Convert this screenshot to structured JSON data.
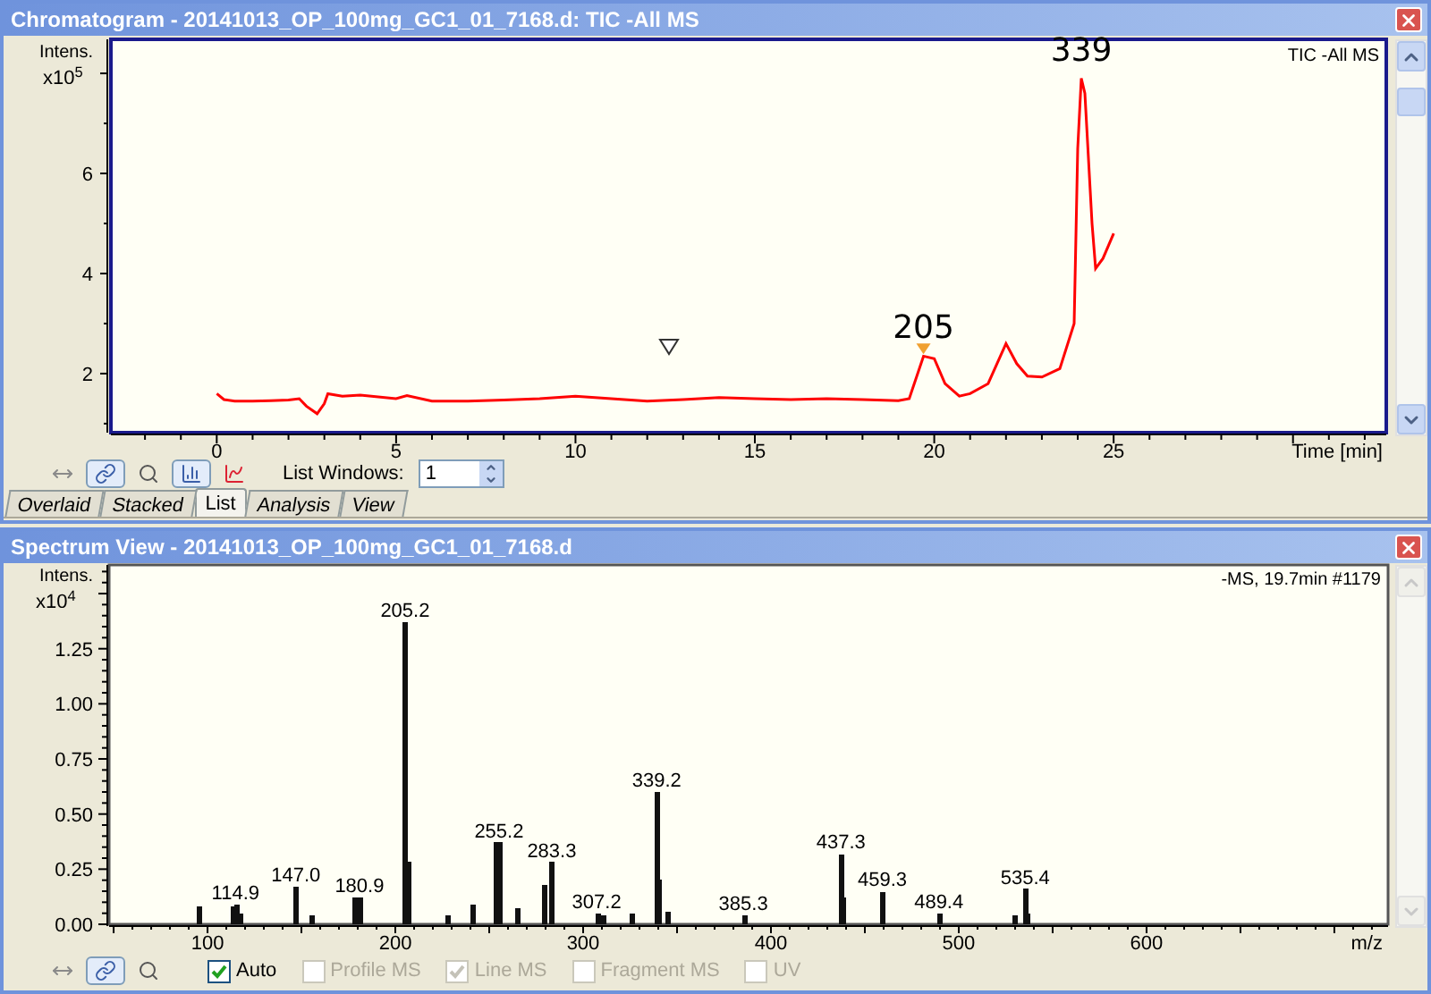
{
  "chromatogram": {
    "title": "Chromatogram - 20141013_OP_100mg_GC1_01_7168.d: TIC -All MS",
    "y_multiplier": "x10$^{5}$",
    "chart_data": {
      "type": "line",
      "xlabel": "Time [min]",
      "ylabel": "Intens.",
      "xlim": [
        -2.95,
        32.6
      ],
      "ylim": [
        0.82,
        8.68
      ],
      "xticks": [
        0,
        5,
        10,
        15,
        20,
        25
      ],
      "yticks": [
        2,
        4,
        6
      ],
      "x": [
        0,
        0.2,
        0.5,
        1,
        1.5,
        2,
        2.3,
        2.5,
        2.8,
        3.0,
        3.1,
        3.5,
        4,
        5,
        5.3,
        6,
        7,
        8,
        9,
        10,
        11,
        12,
        13,
        14,
        15,
        16,
        17,
        18,
        19,
        19.3,
        19.7,
        20,
        20.3,
        20.7,
        21,
        21.5,
        22,
        22.3,
        22.6,
        23,
        23.5,
        23.9,
        24.0,
        24.1,
        24.2,
        24.4,
        24.5,
        24.7,
        25
      ],
      "series": [
        {
          "name": "TIC -All MS",
          "color": "#ff0000",
          "values": [
            1.6,
            1.48,
            1.45,
            1.45,
            1.46,
            1.47,
            1.5,
            1.35,
            1.2,
            1.4,
            1.6,
            1.55,
            1.57,
            1.5,
            1.56,
            1.45,
            1.45,
            1.47,
            1.5,
            1.55,
            1.5,
            1.45,
            1.48,
            1.52,
            1.5,
            1.48,
            1.5,
            1.48,
            1.46,
            1.5,
            2.35,
            2.3,
            1.8,
            1.55,
            1.6,
            1.8,
            2.6,
            2.2,
            1.95,
            1.93,
            2.1,
            3.0,
            6.5,
            7.9,
            7.6,
            5.0,
            4.1,
            4.3,
            4.8
          ]
        }
      ],
      "annotations": [
        {
          "text": "205",
          "x": 19.7,
          "y": 2.35
        },
        {
          "text": "339",
          "x": 24.1,
          "y": 7.9
        }
      ]
    }
  },
  "toolbar": {
    "buttons": [
      {
        "kind": "pan",
        "pressed": false
      },
      {
        "kind": "link",
        "pressed": true
      },
      {
        "kind": "zoom",
        "pressed": false
      },
      {
        "kind": "bars",
        "pressed": true
      },
      {
        "kind": "overlay",
        "pressed": false
      }
    ],
    "list_windows_label": "List Windows:",
    "list_windows_value": "1"
  },
  "tabs": [
    {
      "label": "Overlaid",
      "selected": false
    },
    {
      "label": "Stacked",
      "selected": false
    },
    {
      "label": "List",
      "selected": true
    },
    {
      "label": "Analysis",
      "selected": false
    },
    {
      "label": "View",
      "selected": false
    }
  ],
  "spectrum": {
    "title": "Spectrum View - 20141013_OP_100mg_GC1_01_7168.d",
    "y_multiplier": "x10$^{4}$",
    "trace_label": "-MS, 19.7min #1179",
    "chart_data": {
      "type": "bar",
      "xlabel": "m/z",
      "ylabel": "Intens.",
      "xlim": [
        47.6,
        728.6
      ],
      "ylim": [
        0,
        1.63
      ],
      "xticks": [
        100,
        200,
        300,
        400,
        500,
        600
      ],
      "yticks": [
        {
          "value": 0,
          "label": "0.00"
        },
        {
          "value": 0.25,
          "label": "0.25"
        },
        {
          "value": 0.5,
          "label": "0.50"
        },
        {
          "value": 0.75,
          "label": "0.75"
        },
        {
          "value": 1,
          "label": "1.00"
        },
        {
          "value": 1.25,
          "label": "1.25"
        }
      ],
      "x": [
        95,
        113,
        114.9,
        117,
        147.0,
        155,
        178,
        180.9,
        205.2,
        206.2,
        228,
        241,
        253,
        255.2,
        265,
        279.5,
        283.3,
        307.2,
        310,
        326,
        339.2,
        340.2,
        345,
        385.3,
        437.3,
        437.9,
        459.3,
        489.4,
        530,
        535.4,
        536.4
      ],
      "values": [
        0.08,
        0.08,
        0.09,
        0.05,
        0.17,
        0.04,
        0.12,
        0.12,
        1.37,
        0.28,
        0.04,
        0.09,
        0.37,
        0.37,
        0.07,
        0.18,
        0.28,
        0.05,
        0.04,
        0.05,
        0.6,
        0.2,
        0.06,
        0.04,
        0.32,
        0.12,
        0.15,
        0.05,
        0.04,
        0.16,
        0.05
      ],
      "annotations": [
        {
          "text": "114.9",
          "x": 114.9,
          "y": 0.09
        },
        {
          "text": "147.0",
          "x": 147.0,
          "y": 0.17
        },
        {
          "text": "180.9",
          "x": 180.9,
          "y": 0.12
        },
        {
          "text": "205.2",
          "x": 205.2,
          "y": 1.37
        },
        {
          "text": "255.2",
          "x": 255.2,
          "y": 0.37
        },
        {
          "text": "283.3",
          "x": 283.3,
          "y": 0.28
        },
        {
          "text": "307.2",
          "x": 307.2,
          "y": 0.05
        },
        {
          "text": "339.2",
          "x": 339.2,
          "y": 0.6
        },
        {
          "text": "385.3",
          "x": 385.3,
          "y": 0.04
        },
        {
          "text": "437.3",
          "x": 437.3,
          "y": 0.32
        },
        {
          "text": "459.3",
          "x": 459.3,
          "y": 0.15
        },
        {
          "text": "489.4",
          "x": 489.4,
          "y": 0.05
        },
        {
          "text": "535.4",
          "x": 535.4,
          "y": 0.16
        }
      ]
    }
  },
  "spectrum_toolbar": {
    "buttons": [
      {
        "kind": "pan",
        "pressed": false
      },
      {
        "kind": "link",
        "pressed": true
      },
      {
        "kind": "zoom",
        "pressed": false
      }
    ],
    "checkboxes": [
      {
        "label": "Auto",
        "checked": true,
        "disabled": false
      },
      {
        "label": "Profile MS",
        "checked": false,
        "disabled": true
      },
      {
        "label": "Line MS",
        "checked": true,
        "disabled": true
      },
      {
        "label": "Fragment MS",
        "checked": false,
        "disabled": true
      },
      {
        "label": "UV",
        "checked": false,
        "disabled": true
      }
    ]
  }
}
